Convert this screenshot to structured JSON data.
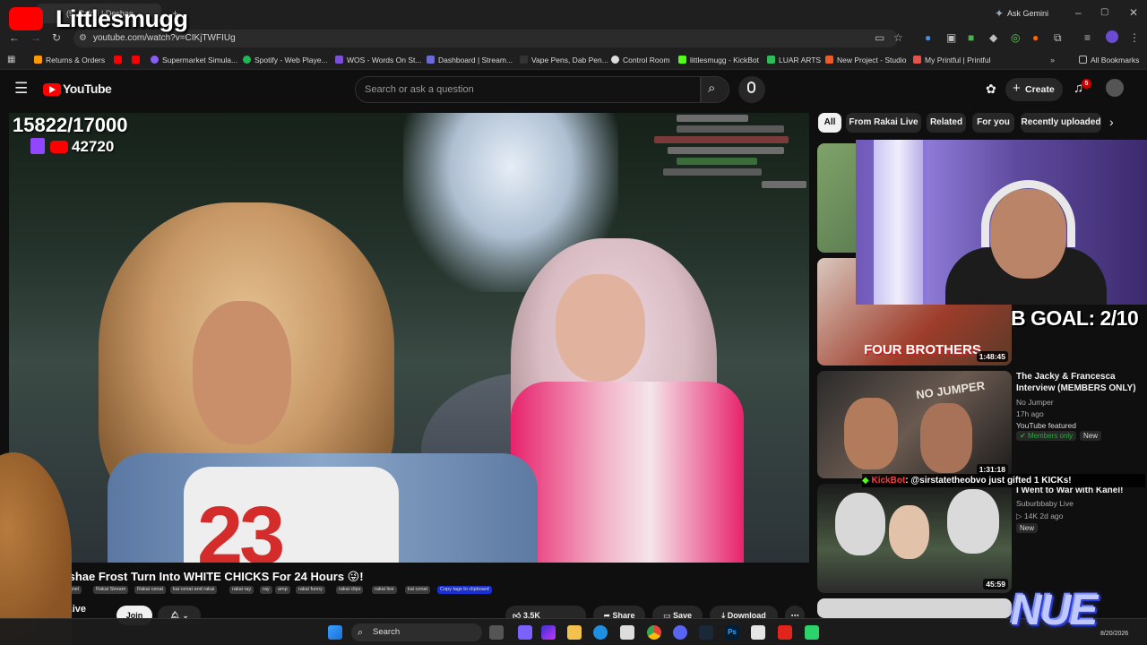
{
  "browser": {
    "tab_label": "(5) Rakai | Deshae Frost Tu...",
    "url": "youtube.com/watch?v=CIKjTWFIUg",
    "ask_gemini": "Ask Gemini",
    "bookmarks": [
      "Returns & Orders",
      "Supermarket Simula...",
      "Spotify - Web Playe...",
      "WOS - Words On St...",
      "Dashboard | Stream...",
      "Vape Pens, Dab Pen...",
      "Control Room",
      "littlesmugg - KickBot",
      "LUAR ARTS",
      "New Project - Studio",
      "My Printful | Printful"
    ],
    "all_bookmarks": "All Bookmarks"
  },
  "overlay": {
    "streamer_name": "Littlesmugg",
    "counter": "15822/17000",
    "sub_count": "42720",
    "goal": "B GOAL: 2/10",
    "kick_user": "KickBot",
    "kick_message": ": @sirstatetheobvo just gifted 1 KICKs!",
    "nue_logo": "NUE"
  },
  "youtube": {
    "logo": "YouTube",
    "search_placeholder": "Search or ask a question",
    "create_label": "Create",
    "notification_count": "5",
    "chips": [
      "All",
      "From Rakai Live",
      "Related",
      "For you",
      "Recently uploaded"
    ],
    "video_title": "Deshae Frost Turn Into WHITE CHICKS For 24 Hours 😜!",
    "tags": [
      "e Channel",
      "Rakai Stream",
      "Rakai cenat",
      "kai cenat and rakai",
      "rakai ray",
      "ray",
      "amp",
      "rakai funny",
      "rakai clips",
      "rakai live",
      "kai cenat"
    ],
    "copy_tags": "Copy tags to clipboard",
    "channel_suffix": "Live",
    "join_label": "Join",
    "like_count": "3.5K",
    "share_label": "Share",
    "save_label": "Save",
    "download_label": "Download",
    "sidebar": [
      {
        "duration": "1:48:45",
        "title": "",
        "channel": "",
        "meta": ""
      },
      {
        "duration": "1:31:18",
        "title": "The Jacky & Francesca Interview (MEMBERS ONLY)",
        "channel": "No Jumper",
        "meta": "17h ago",
        "featured": "YouTube featured",
        "members": "Members only",
        "new": "New"
      },
      {
        "duration": "45:59",
        "title": "I Went to War with Kanel!",
        "channel": "Suburbbaby Live",
        "meta": "14K  2d ago",
        "new": "New"
      }
    ],
    "thumb_text_fourbrothers": "FOUR BROTHERS",
    "thumb_text_nojumper": "NO JUMPER"
  },
  "taskbar": {
    "search_label": "Search",
    "date": "8/20/2026"
  },
  "colors": {
    "youtube_red": "#ff0000",
    "twitch_purple": "#9146ff",
    "kick_green": "#53fc18",
    "accent_blue": "#3ea6ff"
  }
}
